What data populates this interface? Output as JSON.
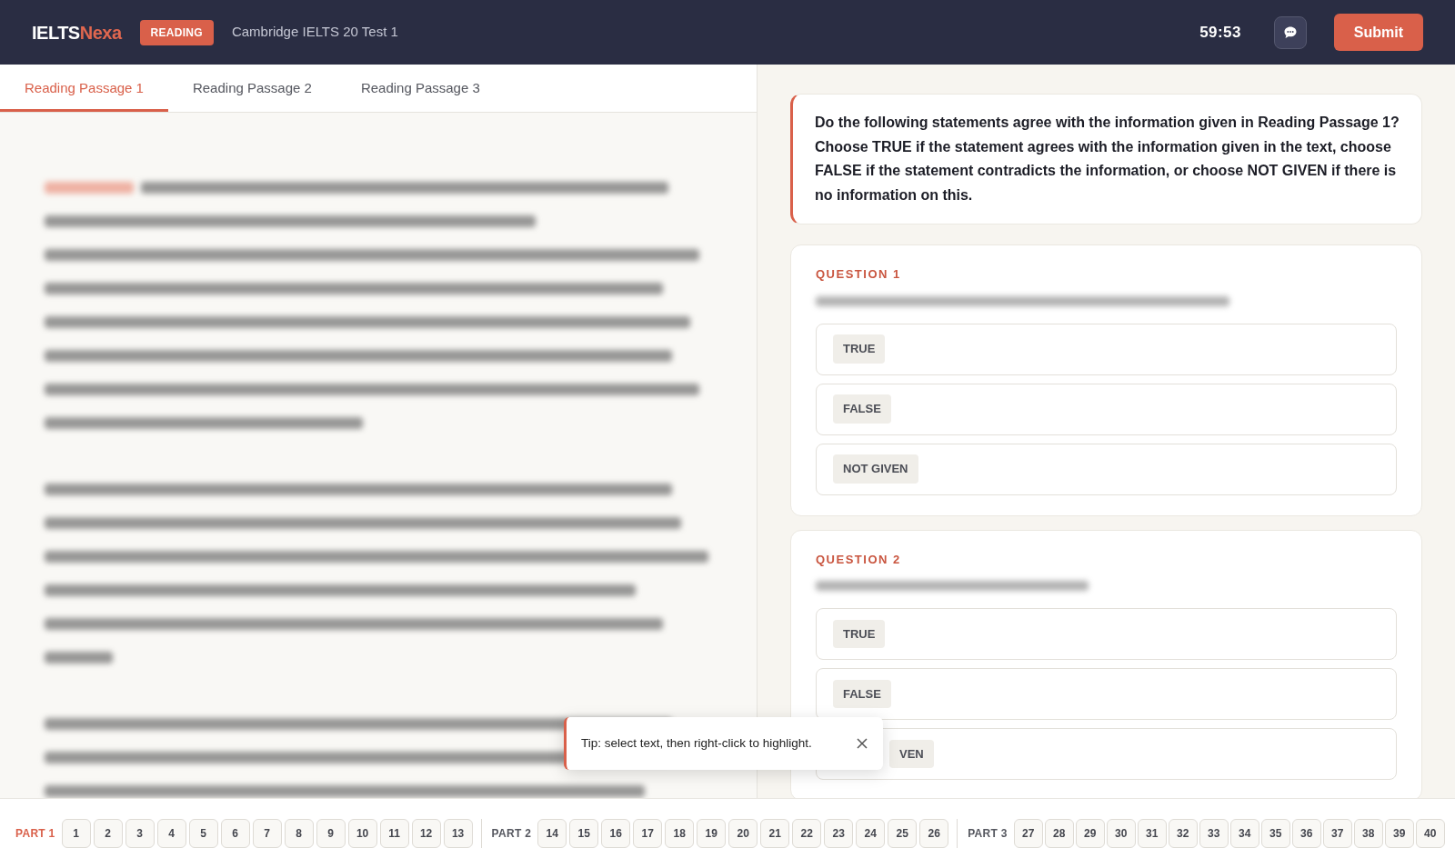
{
  "header": {
    "logo": {
      "main": "IELTS",
      "accent": "Nexa"
    },
    "badge": "READING",
    "test_title": "Cambridge IELTS 20 Test 1",
    "timer": "59:53",
    "submit": "Submit"
  },
  "tabs": [
    {
      "label": "Reading Passage 1",
      "selected": true
    },
    {
      "label": "Reading Passage 2",
      "selected": false
    },
    {
      "label": "Reading Passage 3",
      "selected": false
    }
  ],
  "instructions": "Do the following statements agree with the information given in Reading Passage 1? Choose TRUE if the statement agrees with the information given in the text, choose FALSE if the statement contradicts the information, or choose NOT GIVEN if there is no information on this.",
  "questions": [
    {
      "label": "QUESTION 1",
      "options": [
        {
          "label": "TRUE",
          "selected": false
        },
        {
          "label": "FALSE",
          "selected": false
        },
        {
          "label": "NOT GIVEN",
          "selected": false
        }
      ]
    },
    {
      "label": "QUESTION 2",
      "options": [
        {
          "label": "TRUE",
          "selected": false
        },
        {
          "label": "FALSE",
          "selected": false
        },
        {
          "label": "VEN",
          "selected": false
        }
      ]
    }
  ],
  "toast": {
    "text": "Tip: select text, then right-click to highlight."
  },
  "footer": {
    "parts": [
      {
        "label": "PART 1",
        "selected": true,
        "questions": [
          "1",
          "2",
          "3",
          "4",
          "5",
          "6",
          "7",
          "8",
          "9",
          "10",
          "11",
          "12",
          "13"
        ]
      },
      {
        "label": "PART 2",
        "selected": false,
        "questions": [
          "14",
          "15",
          "16",
          "17",
          "18",
          "19",
          "20",
          "21",
          "22",
          "23",
          "24",
          "25",
          "26"
        ]
      },
      {
        "label": "PART 3",
        "selected": false,
        "questions": [
          "27",
          "28",
          "29",
          "30",
          "31",
          "32",
          "33",
          "34",
          "35",
          "36",
          "37",
          "38",
          "39",
          "40"
        ]
      }
    ]
  }
}
